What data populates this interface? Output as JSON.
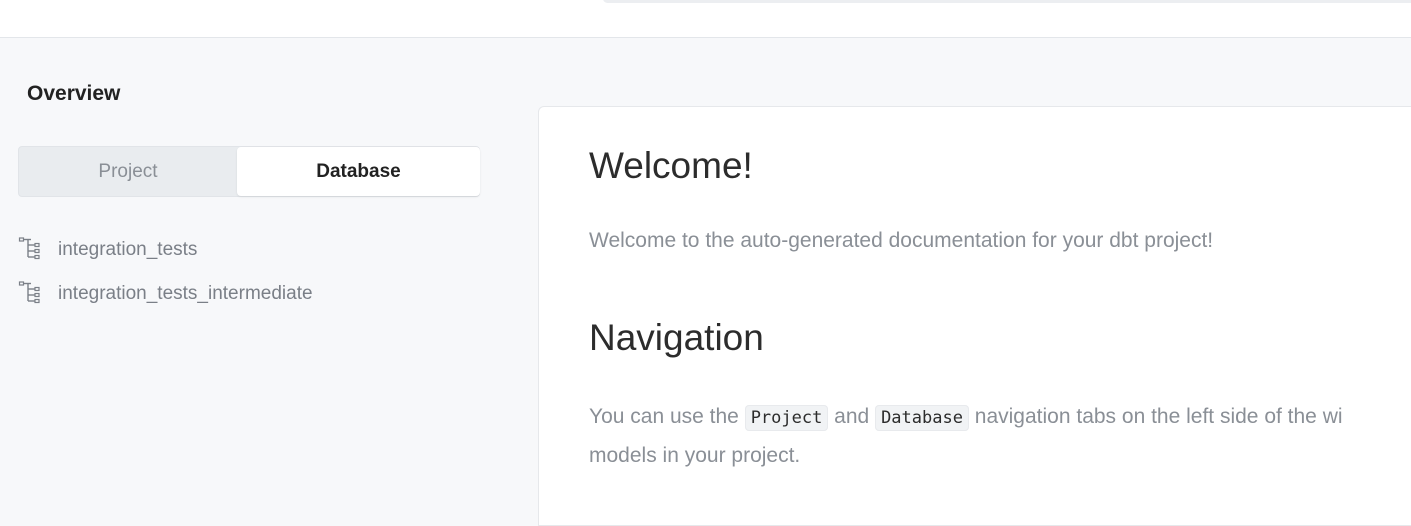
{
  "sidebar": {
    "title": "Overview",
    "tabs": [
      {
        "label": "Project",
        "active": false
      },
      {
        "label": "Database",
        "active": true
      }
    ],
    "tree": [
      {
        "label": "integration_tests",
        "icon": "schema-tree-icon"
      },
      {
        "label": "integration_tests_intermediate",
        "icon": "schema-tree-icon"
      }
    ]
  },
  "main": {
    "welcome_heading": "Welcome!",
    "welcome_text": "Welcome to the auto-generated documentation for your dbt project!",
    "nav_heading": "Navigation",
    "nav_text_1": "You can use the ",
    "nav_code_1": "Project",
    "nav_text_2": " and ",
    "nav_code_2": "Database",
    "nav_text_3": " navigation tabs on the left side of the wi",
    "nav_text_4": "models in your project."
  }
}
